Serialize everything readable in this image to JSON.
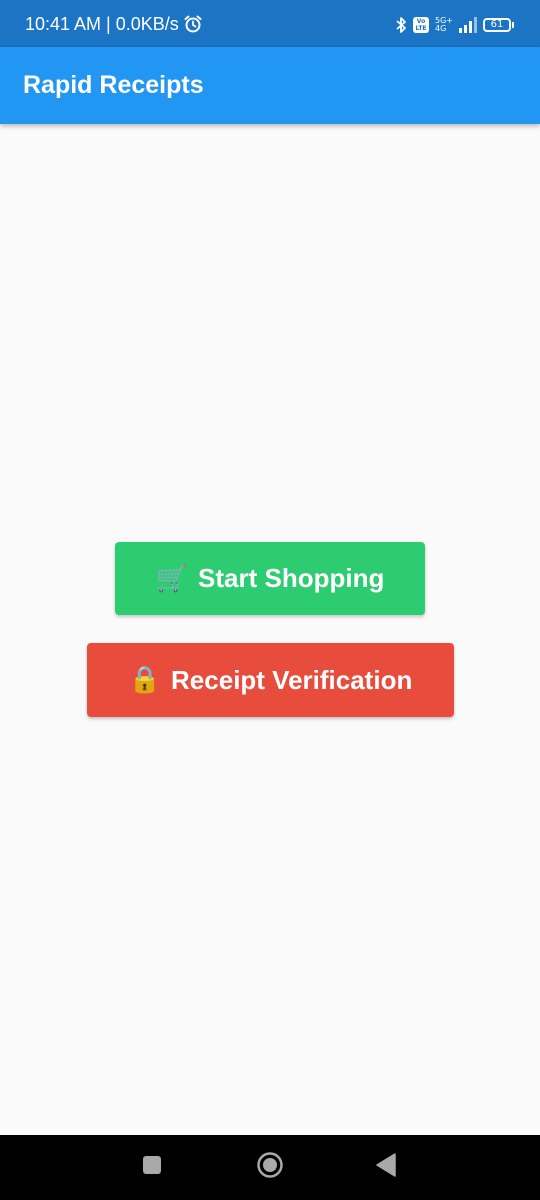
{
  "status_bar": {
    "time_speed": "10:41 AM | 0.0KB/s",
    "volte_label": "Vo LTE",
    "network_top": "5G+",
    "network_bottom": "4G",
    "battery_level": "61",
    "icons": [
      "alarm-icon",
      "bluetooth-icon",
      "volte-icon",
      "signal-icon",
      "battery-icon"
    ]
  },
  "app_bar": {
    "title": "Rapid Receipts",
    "color": "#2196f3"
  },
  "main": {
    "start_button": {
      "emoji": "🛒",
      "label": "Start Shopping",
      "color": "#2ecc71"
    },
    "verify_button": {
      "emoji": "🔒",
      "label": "Receipt Verification",
      "color": "#e74c3c"
    }
  },
  "nav_bar": {
    "icons": [
      "recents-square-icon",
      "home-circle-icon",
      "back-triangle-icon"
    ]
  }
}
